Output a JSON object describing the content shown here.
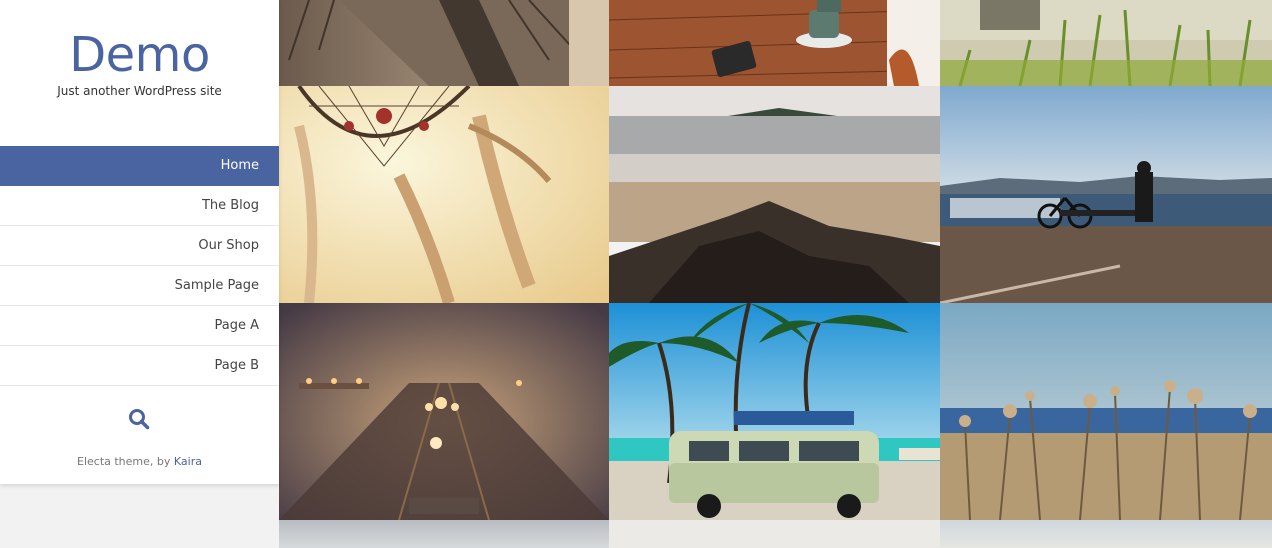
{
  "site": {
    "title": "Demo",
    "tagline": "Just another WordPress site"
  },
  "menu": [
    {
      "label": "Home",
      "active": true
    },
    {
      "label": "The Blog",
      "active": false
    },
    {
      "label": "Our Shop",
      "active": false
    },
    {
      "label": "Sample Page",
      "active": false
    },
    {
      "label": "Page A",
      "active": false
    },
    {
      "label": "Page B",
      "active": false
    }
  ],
  "search": {
    "icon": "search-icon"
  },
  "footer": {
    "credit_prefix": "Electa theme, by ",
    "credit_link": "Kaira"
  },
  "colors": {
    "accent": "#4a64a1",
    "sidebar_bg": "#ffffff",
    "page_bg": "#f2f2f2"
  },
  "gallery": [
    {
      "subject": "boardwalk"
    },
    {
      "subject": "coffee-table"
    },
    {
      "subject": "grass"
    },
    {
      "subject": "dreamcatcher"
    },
    {
      "subject": "beach-rocks"
    },
    {
      "subject": "man-bicycle-sea"
    },
    {
      "subject": "foggy-railway"
    },
    {
      "subject": "van-palms"
    },
    {
      "subject": "dry-flowers-sea"
    },
    {
      "subject": "next-row-1"
    },
    {
      "subject": "next-row-2"
    },
    {
      "subject": "next-row-3"
    }
  ]
}
